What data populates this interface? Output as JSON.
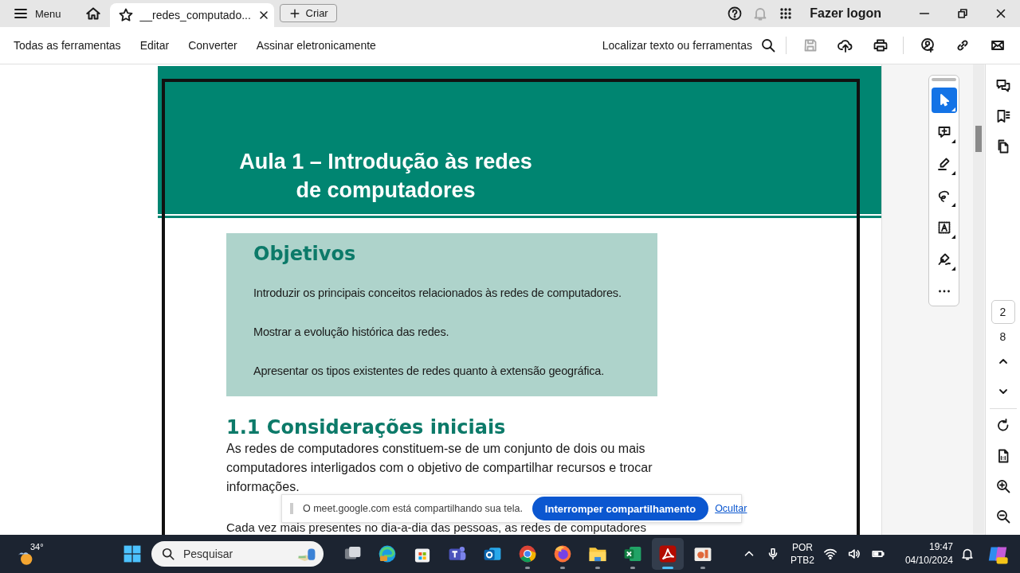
{
  "title_bar": {
    "menu_label": "Menu",
    "tabs": [
      {
        "title": "__redes_computado...",
        "selected": true
      }
    ],
    "create_button": "Criar",
    "sign_in": "Fazer logon"
  },
  "toolbar": {
    "items": [
      "Todas as ferramentas",
      "Editar",
      "Converter",
      "Assinar eletronicamente"
    ],
    "search_label": "Localizar texto ou ferramentas"
  },
  "document": {
    "title_lines": [
      "Aula 1 – Introdução às redes",
      "de computadores"
    ],
    "objectives": {
      "title": "Objetivos",
      "items": [
        "Introduzir os principais conceitos relacionados às redes de computadores.",
        "Mostrar a evolução histórica das redes.",
        "Apresentar os tipos existentes de redes quanto à extensão geográfica."
      ]
    },
    "section_heading": "1.1 Considerações iniciais",
    "paragraphs": [
      "As redes de computadores constituem-se de um conjunto de dois ou mais computadores interligados com o objetivo de compartilhar recursos e trocar informações.",
      "Cada vez mais presentes no dia-a-dia das pessoas, as redes de computadores"
    ]
  },
  "tools": [
    {
      "kind": "select",
      "selected": true
    },
    {
      "kind": "comment",
      "selected": false
    },
    {
      "kind": "highlight",
      "selected": false
    },
    {
      "kind": "draw",
      "selected": false
    },
    {
      "kind": "text",
      "selected": false
    },
    {
      "kind": "sign",
      "selected": false
    },
    {
      "kind": "more",
      "selected": false
    }
  ],
  "page_nav": {
    "current": "2",
    "total": "8"
  },
  "share_banner": {
    "message": "O meet.google.com está compartilhando sua tela.",
    "stop_button": "Interromper compartilhamento",
    "hide_link": "Ocultar"
  },
  "taskbar": {
    "weather": "34°",
    "search_placeholder": "Pesquisar",
    "apps": [
      {
        "kind": "taskview",
        "running": false,
        "selected": false
      },
      {
        "kind": "edge",
        "running": false,
        "selected": false
      },
      {
        "kind": "store",
        "running": false,
        "selected": false
      },
      {
        "kind": "teams",
        "running": false,
        "selected": false
      },
      {
        "kind": "outlook",
        "running": false,
        "selected": false
      },
      {
        "kind": "chrome",
        "running": true,
        "selected": false
      },
      {
        "kind": "firefox",
        "running": true,
        "selected": false
      },
      {
        "kind": "explorer",
        "running": true,
        "selected": false
      },
      {
        "kind": "excel",
        "running": true,
        "selected": false
      },
      {
        "kind": "acrobat",
        "running": true,
        "selected": true
      },
      {
        "kind": "slides",
        "running": true,
        "selected": false
      }
    ],
    "language": [
      "POR",
      "PTB2"
    ],
    "time": "19:47",
    "date": "04/10/2024"
  }
}
